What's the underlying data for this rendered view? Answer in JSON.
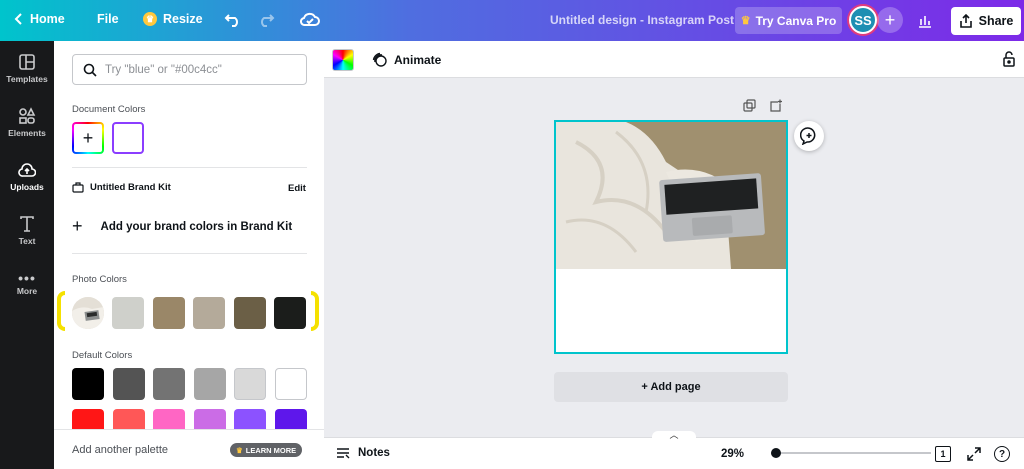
{
  "topbar": {
    "home_label": "Home",
    "file_label": "File",
    "resize_label": "Resize",
    "doc_title": "Untitled design - Instagram Post",
    "try_pro_label": "Try Canva Pro",
    "avatar_initials": "SS",
    "share_label": "Share"
  },
  "sidebar": {
    "items": [
      {
        "label": "Templates",
        "icon": "templates-icon"
      },
      {
        "label": "Elements",
        "icon": "elements-icon"
      },
      {
        "label": "Uploads",
        "icon": "uploads-icon",
        "active": true
      },
      {
        "label": "Text",
        "icon": "text-icon"
      },
      {
        "label": "More",
        "icon": "more-icon"
      }
    ]
  },
  "panel": {
    "search_placeholder": "Try \"blue\" or \"#00c4cc\"",
    "document_colors_title": "Document Colors",
    "brand_kit_label": "Untitled Brand Kit",
    "edit_label": "Edit",
    "add_brand_colors": "Add your brand colors in Brand Kit",
    "photo_colors_title": "Photo Colors",
    "photo_colors": [
      "#cfd0cb",
      "#9a8768",
      "#b4aa9a",
      "#6b5f46",
      "#1b1d1b"
    ],
    "default_colors_title": "Default Colors",
    "default_colors_row1": [
      "#000000",
      "#545454",
      "#737373",
      "#a6a6a6",
      "#d9d9d9",
      "#ffffff"
    ],
    "default_colors_row2": [
      "#ff1616",
      "#ff5757",
      "#ff66c4",
      "#cb6ce6",
      "#8c52ff",
      "#5e17eb"
    ],
    "add_palette_label": "Add another palette",
    "learn_more_label": "LEARN MORE"
  },
  "toolbar": {
    "animate_label": "Animate"
  },
  "canvas": {
    "add_page_label": "+ Add page"
  },
  "bottombar": {
    "notes_label": "Notes",
    "zoom_label": "29%",
    "zoom_fraction": 0.0,
    "page_count": "1",
    "help_label": "?"
  }
}
